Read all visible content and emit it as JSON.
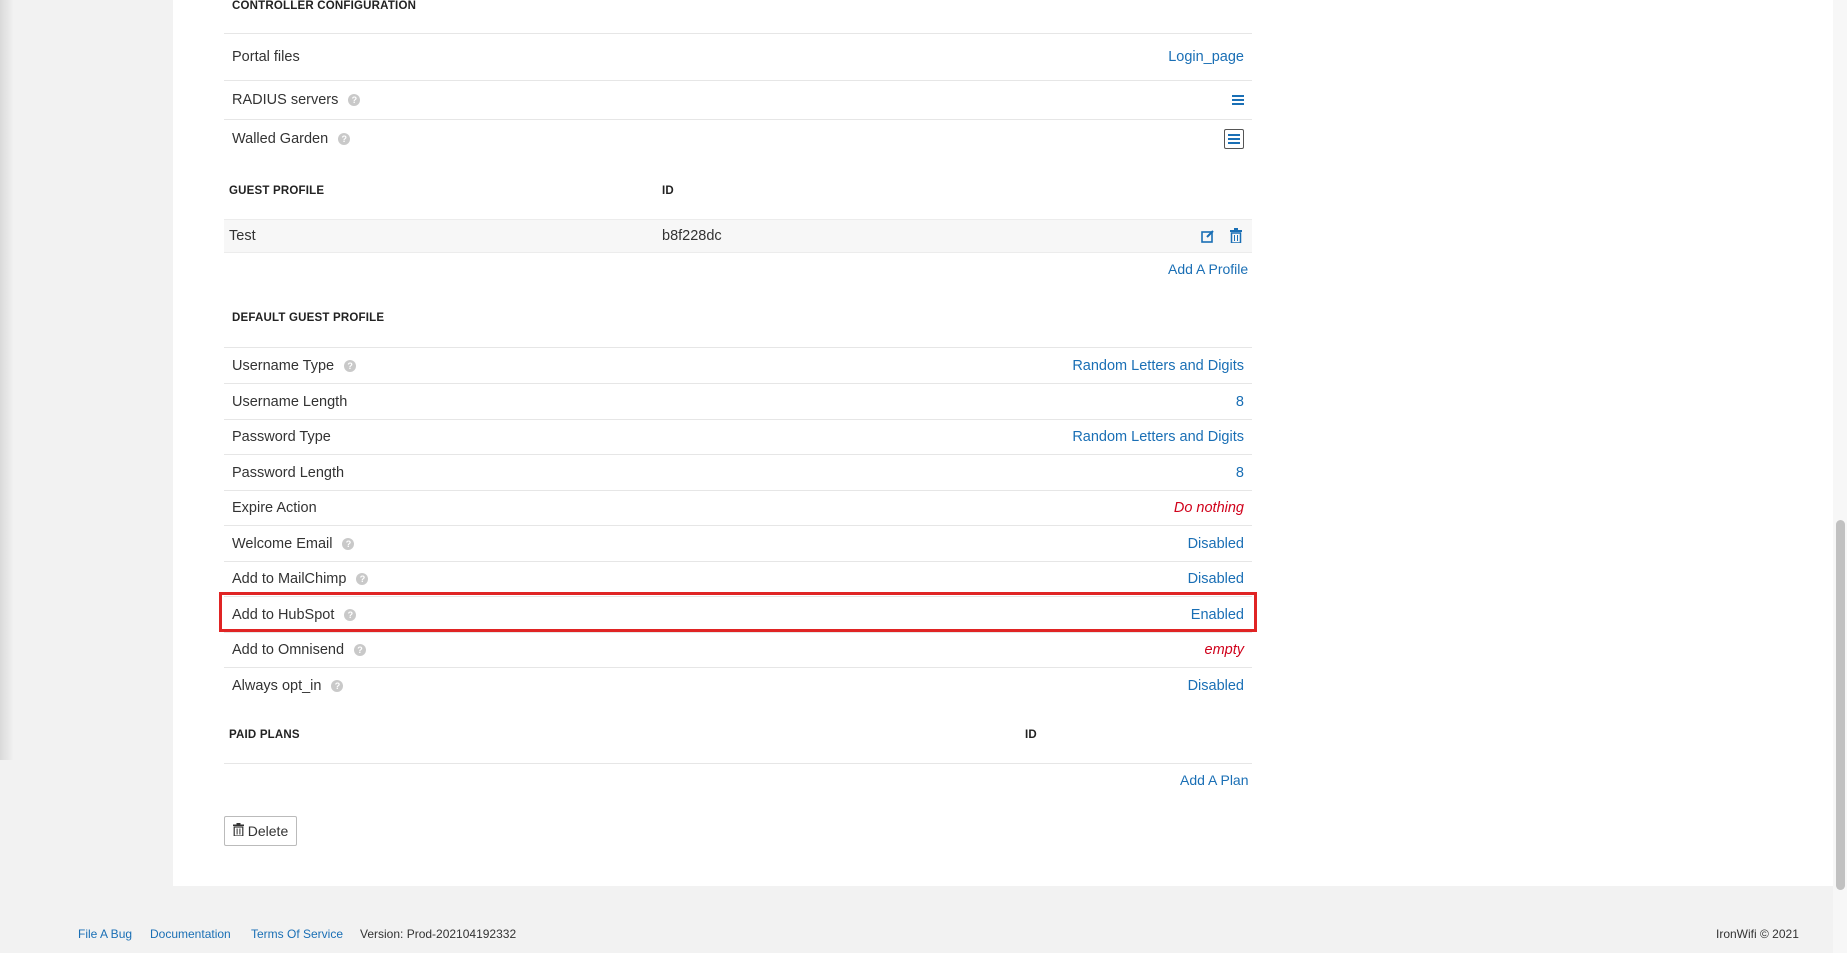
{
  "controller": {
    "title": "CONTROLLER CONFIGURATION",
    "rows": [
      {
        "label": "Portal files",
        "value": "Login_page"
      },
      {
        "label": "RADIUS servers"
      },
      {
        "label": "Walled Garden"
      }
    ]
  },
  "guest_profile": {
    "col_name": "GUEST PROFILE",
    "col_id": "ID",
    "row": {
      "name": "Test",
      "id": "b8f228dc"
    },
    "add_label": "Add A Profile"
  },
  "default_profile": {
    "title": "DEFAULT GUEST PROFILE",
    "rows": [
      {
        "label": "Username Type",
        "value": "Random Letters and Digits"
      },
      {
        "label": "Username Length",
        "value": "8"
      },
      {
        "label": "Password Type",
        "value": "Random Letters and Digits"
      },
      {
        "label": "Password Length",
        "value": "8"
      },
      {
        "label": "Expire Action",
        "value": "Do nothing"
      },
      {
        "label": "Welcome Email",
        "value": "Disabled"
      },
      {
        "label": "Add to MailChimp",
        "value": "Disabled"
      },
      {
        "label": "Add to HubSpot",
        "value": "Enabled"
      },
      {
        "label": "Add to Omnisend",
        "value": "empty"
      },
      {
        "label": "Always opt_in",
        "value": "Disabled"
      }
    ]
  },
  "paid_plans": {
    "col_name": "PAID PLANS",
    "col_id": "ID",
    "add_label": "Add A Plan"
  },
  "delete_label": "Delete",
  "footer": {
    "links": [
      "File A Bug",
      "Documentation",
      "Terms Of Service"
    ],
    "version": "Version: Prod-202104192332",
    "copyright": "IronWifi © 2021"
  },
  "colors": {
    "link": "#1a6fb5",
    "warning": "#d0021b",
    "highlight": "#e02424"
  },
  "icons": {
    "help": "question-circle",
    "list": "list-icon",
    "edit": "edit-icon",
    "trash": "trash-icon"
  }
}
